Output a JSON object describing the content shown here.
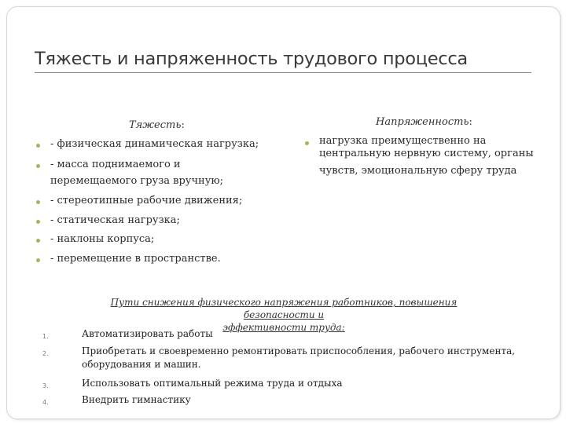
{
  "title": "Тяжесть и напряженность трудового процесса",
  "left_column": {
    "heading": "Тяжесть",
    "heading_colon": ":",
    "items": [
      "- физическая динамическая нагрузка;",
      "- масса поднимаемого и",
      "перемещаемого груза вручную;",
      "- стереотипные рабочие движения;",
      "- статическая нагрузка;",
      "- наклоны корпуса;",
      "- перемещение в пространстве."
    ]
  },
  "right_column": {
    "heading": "Напряженность",
    "heading_colon": ":",
    "lines": [
      "нагрузка преимущественно на",
      "центральную нервную систему, органы",
      "чувств, эмоциональную сферу труда"
    ]
  },
  "paths": {
    "heading_line1": "Пути снижения физического напряжения работников, повышения безопасности и",
    "heading_line2": "эффективности труда:",
    "items": [
      {
        "marker": "1.",
        "lines": [
          "Автоматизировать работы"
        ]
      },
      {
        "marker": "2.",
        "lines": [
          "Приобретать и своевременно ремонтировать приспособления, рабочего инструмента,",
          "оборудования и машин."
        ]
      },
      {
        "marker": "3.",
        "lines": [
          "Использовать оптимальный режима труда и отдыха"
        ]
      },
      {
        "marker": "4.",
        "lines": [
          "Внедрить гимнастику"
        ]
      }
    ]
  },
  "colors": {
    "bullet": "#9bbb59",
    "border": "#d4d9d4"
  }
}
